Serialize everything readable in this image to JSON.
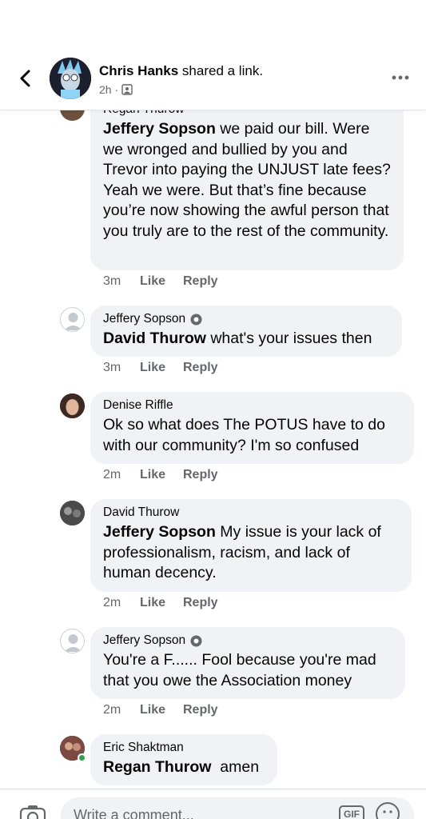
{
  "header": {
    "author": "Chris Hanks",
    "action": " shared a link.",
    "time": "2h ·"
  },
  "comments": [
    {
      "author": "Regan Thurow",
      "mention": "Jeffery Sopson",
      "text": " we paid our bill. Were we wronged and bullied by you and Trevor into paying the UNJUST late fees? Yeah we were. But that’s fine because you’re now showing the awful person that you truly are to the rest of the community.",
      "time": "3m",
      "like": "Like",
      "reply": "Reply"
    },
    {
      "author": "Jeffery Sopson",
      "mention": "David Thurow",
      "text": " what's your issues then",
      "time": "3m",
      "like": "Like",
      "reply": "Reply"
    },
    {
      "author": "Denise Riffle",
      "mention": "",
      "text": "Ok so what does The POTUS have to do with our community? I'm so confused",
      "time": "2m",
      "like": "Like",
      "reply": "Reply"
    },
    {
      "author": "David Thurow",
      "mention": "Jeffery Sopson",
      "text": " My issue is your lack of professionalism, racism, and lack of human decency.",
      "time": "2m",
      "like": "Like",
      "reply": "Reply"
    },
    {
      "author": "Jeffery Sopson",
      "mention": "",
      "text": "You're a F...... Fool because you're mad that you owe the Association money",
      "time": "2m",
      "like": "Like",
      "reply": "Reply"
    },
    {
      "author": "Eric Shaktman",
      "mention": "Regan Thurow",
      "text": "  amen"
    }
  ],
  "composer": {
    "placeholder": "Write a comment...",
    "gif_label": "GIF"
  },
  "colors": {
    "bubble": "#f0f2f5",
    "secondary_text": "#65676b",
    "online": "#31a24c"
  }
}
